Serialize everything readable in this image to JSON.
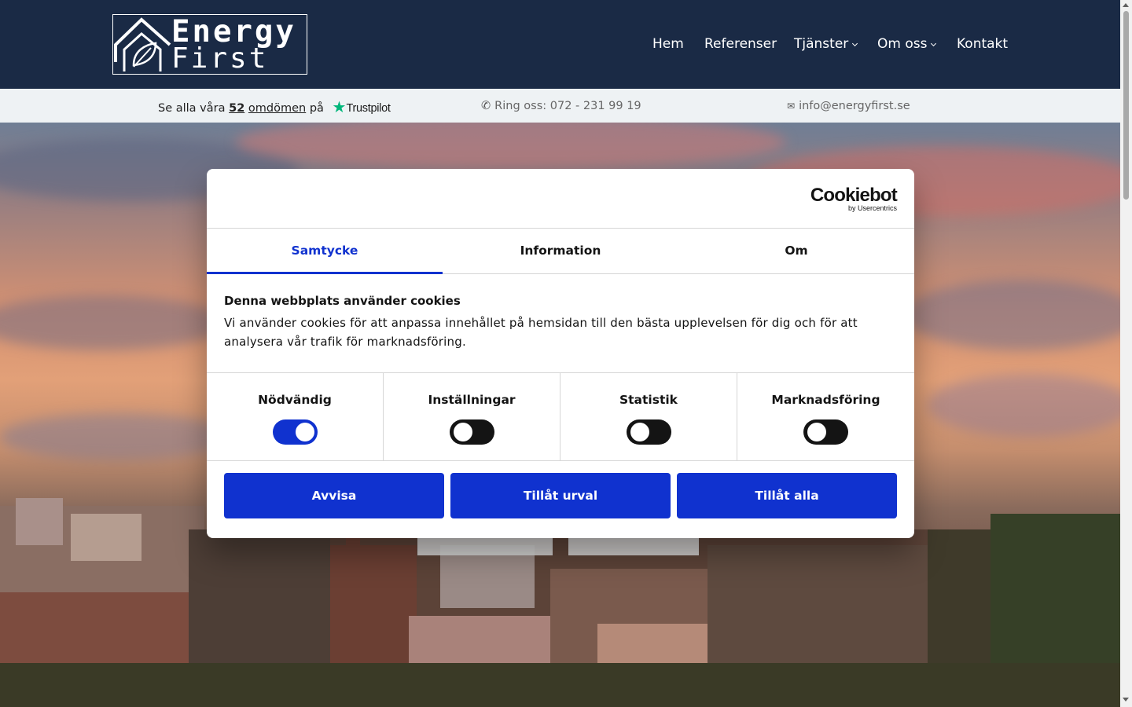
{
  "header": {
    "logo": {
      "line1": "Energy",
      "line2": "First"
    },
    "nav": [
      {
        "label": "Hem"
      },
      {
        "label": "Referenser"
      },
      {
        "label": "Tjänster"
      },
      {
        "label": "Om oss"
      },
      {
        "label": "Kontakt"
      }
    ]
  },
  "infobar": {
    "reviews_prefix": "Se alla våra",
    "reviews_count": "52",
    "reviews_link": "omdömen",
    "reviews_suffix": "på",
    "trustpilot": "Trustpilot",
    "phone": "Ring oss: 072 - 231 99 19",
    "email": "info@energyfirst.se"
  },
  "cookie_dialog": {
    "brand": "Cookiebot",
    "brand_sub": "by Usercentrics",
    "tabs": [
      {
        "label": "Samtycke",
        "active": true
      },
      {
        "label": "Information",
        "active": false
      },
      {
        "label": "Om",
        "active": false
      }
    ],
    "title": "Denna webbplats använder cookies",
    "text": "Vi använder cookies för att anpassa innehållet på hemsidan till den bästa upplevelsen för dig och för att analysera vår trafik för marknadsföring.",
    "toggles": [
      {
        "label": "Nödvändig",
        "on": true
      },
      {
        "label": "Inställningar",
        "on": false
      },
      {
        "label": "Statistik",
        "on": false
      },
      {
        "label": "Marknadsföring",
        "on": false
      }
    ],
    "buttons": {
      "reject": "Avvisa",
      "allow_selection": "Tillåt urval",
      "allow_all": "Tillåt alla"
    }
  },
  "colors": {
    "header_bg": "#1a2a45",
    "accent": "#1032cf",
    "trustpilot_green": "#00b67a",
    "infobar_bg": "#eef2f4"
  }
}
